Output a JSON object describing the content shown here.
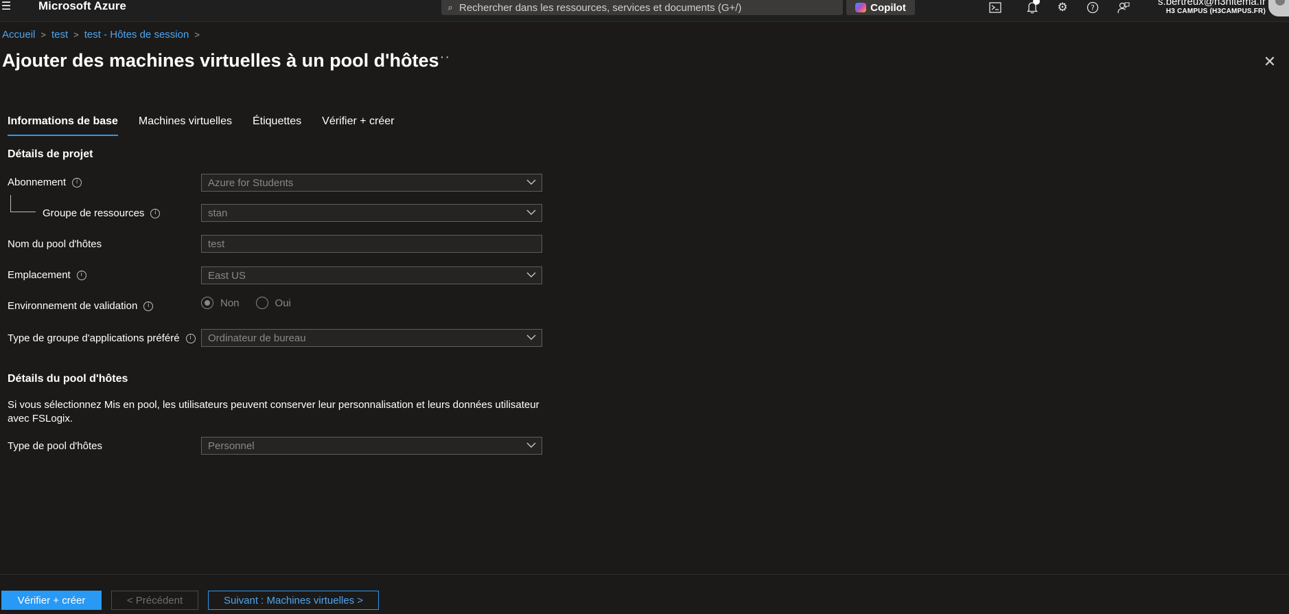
{
  "topbar": {
    "menu_icon": "hamburger-icon",
    "brand": "Microsoft Azure",
    "search_placeholder": "Rechercher dans les ressources, services et documents (G+/)",
    "copilot_label": "Copilot",
    "icons": [
      "cloud-shell-icon",
      "notifications-icon",
      "settings-icon",
      "help-icon",
      "feedback-icon"
    ],
    "account_email": "s.bertreux@h3hitema.fr",
    "account_tenant": "H3 CAMPUS (H3CAMPUS.FR)"
  },
  "breadcrumb": {
    "items": [
      "Accueil",
      "test",
      "test - Hôtes de session"
    ],
    "separator": ">"
  },
  "page": {
    "title": "Ajouter des machines virtuelles à un pool d'hôtes",
    "more_label": "···",
    "close_label": "✕"
  },
  "tabs": [
    {
      "label": "Informations de base",
      "active": true
    },
    {
      "label": "Machines virtuelles",
      "active": false
    },
    {
      "label": "Étiquettes",
      "active": false
    },
    {
      "label": "Vérifier + créer",
      "active": false
    }
  ],
  "project_details": {
    "heading": "Détails de projet",
    "subscription": {
      "label": "Abonnement",
      "value": "Azure for Students"
    },
    "resource_group": {
      "label": "Groupe de ressources",
      "value": "stan"
    },
    "host_pool_name": {
      "label": "Nom du pool d'hôtes",
      "value": "test"
    },
    "location": {
      "label": "Emplacement",
      "value": "East US"
    },
    "validation_env": {
      "label": "Environnement de validation",
      "options": [
        "Non",
        "Oui"
      ],
      "selected": "Non"
    },
    "app_group_type": {
      "label": "Type de groupe d'applications préféré",
      "value": "Ordinateur de bureau"
    }
  },
  "host_pool_details": {
    "heading": "Détails du pool d'hôtes",
    "description": "Si vous sélectionnez Mis en pool, les utilisateurs peuvent conserver leur personnalisation et leurs données utilisateur avec FSLogix.",
    "pool_type": {
      "label": "Type de pool d'hôtes",
      "value": "Personnel"
    }
  },
  "footer": {
    "review_create": "Vérifier + créer",
    "previous": "< Précédent",
    "next": "Suivant : Machines virtuelles >"
  },
  "colors": {
    "background": "#1b1a19",
    "accent": "#2899f5",
    "link": "#4ea5f0"
  }
}
